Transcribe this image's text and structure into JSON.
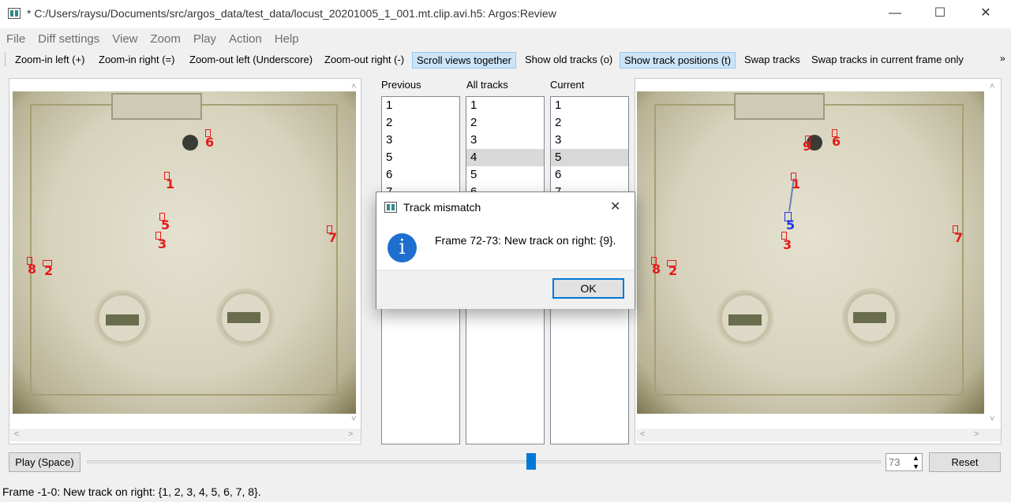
{
  "window": {
    "title": "* C:/Users/raysu/Documents/src/argos_data/test_data/locust_20201005_1_001.mt.clip.avi.h5: Argos:Review",
    "minimize": "—",
    "maximize": "☐",
    "close": "✕"
  },
  "menu": [
    "File",
    "Diff settings",
    "View",
    "Zoom",
    "Play",
    "Action",
    "Help"
  ],
  "toolbar": {
    "zoom_in_left": "Zoom-in left (+)",
    "zoom_in_right": "Zoom-in right (=)",
    "zoom_out_left": "Zoom-out left (Underscore)",
    "zoom_out_right": "Zoom-out right (-)",
    "scroll_together": "Scroll views together",
    "show_old_tracks": "Show old tracks (o)",
    "show_track_positions": "Show track positions (t)",
    "swap_tracks": "Swap tracks",
    "swap_tracks_current": "Swap tracks in current frame only",
    "more": "»"
  },
  "left_view": {
    "track_labels": [
      "6",
      "1",
      "5",
      "3",
      "7",
      "8",
      "2"
    ]
  },
  "right_view": {
    "track_labels": [
      "9",
      "6",
      "1",
      "5",
      "3",
      "7",
      "8",
      "2"
    ]
  },
  "lists": {
    "previous": {
      "label": "Previous",
      "items": [
        "1",
        "2",
        "3",
        "5",
        "6",
        "7"
      ]
    },
    "all_tracks": {
      "label": "All tracks",
      "items": [
        "1",
        "2",
        "3",
        "4",
        "5",
        "6"
      ],
      "selected": "4"
    },
    "current": {
      "label": "Current",
      "items": [
        "1",
        "2",
        "3",
        "5",
        "6",
        "7"
      ],
      "selected": "5"
    }
  },
  "dialog": {
    "title": "Track mismatch",
    "message": "Frame 72-73: New track on right: {9}.",
    "ok_label": "OK",
    "close": "✕",
    "icon": "info-icon"
  },
  "playback": {
    "play_label": "Play (Space)",
    "frame_value": "73",
    "reset_label": "Reset"
  },
  "status": {
    "text": "Frame -1-0: New track on right: {1, 2, 3, 4, 5, 6, 7, 8}."
  },
  "colors": {
    "track_label": "#e51b1b",
    "selected_track": "#1b33e5",
    "toggle_on": "#cce4f7",
    "info_icon": "#1e6fcf"
  }
}
